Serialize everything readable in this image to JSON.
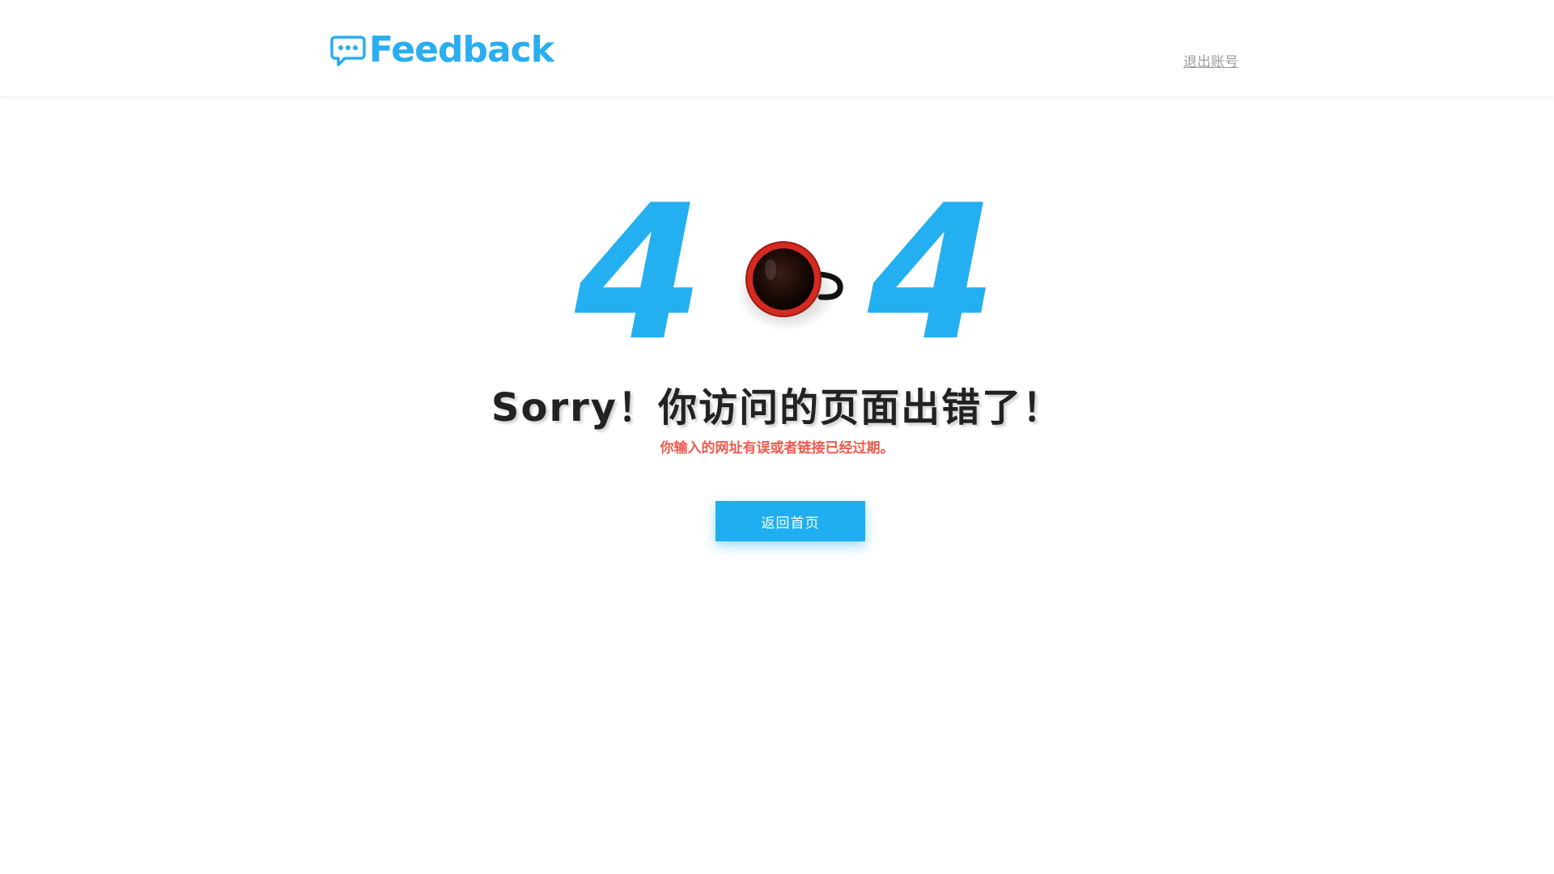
{
  "header": {
    "logo_text": "Feedback",
    "logout_label": "退出账号"
  },
  "error": {
    "digit_left": "4",
    "digit_right": "4",
    "headline": "Sorry！你访问的页面出错了！",
    "message": "你输入的网址有误或者链接已经过期。",
    "home_button_label": "返回首页"
  },
  "colors": {
    "accent": "#24b0f0",
    "error_text": "#ef5a4d",
    "headline": "#222222",
    "link_muted": "#9a9a9a"
  },
  "icons": {
    "logo": "chat-bubble-icon",
    "zero": "coffee-cup-icon"
  }
}
